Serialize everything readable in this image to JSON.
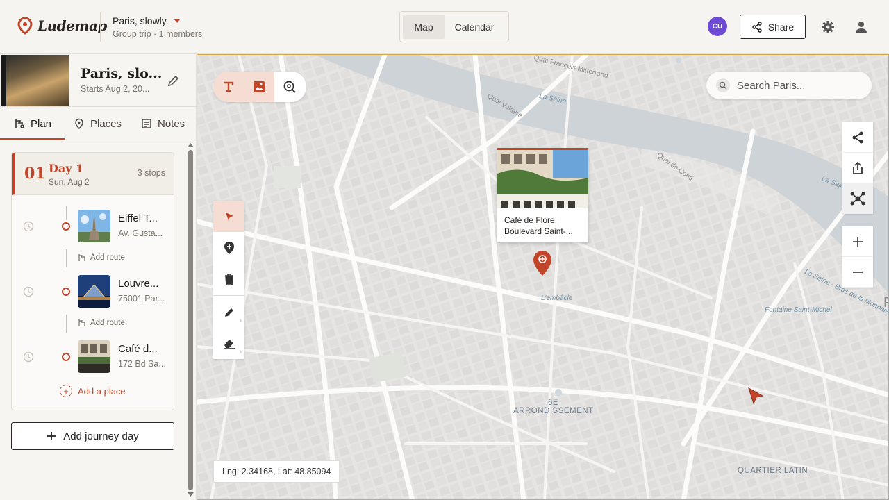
{
  "header": {
    "logo_text": "Ludemap",
    "trip_title": "Paris, slowly.",
    "trip_subtitle": "Group trip · 1 members",
    "view_tabs": [
      {
        "label": "Map",
        "active": true
      },
      {
        "label": "Calendar",
        "active": false
      }
    ],
    "avatar_initials": "CU",
    "share_label": "Share",
    "icons": [
      "settings-icon",
      "user-icon"
    ]
  },
  "sidebar": {
    "trip_name": "Paris, slo...",
    "trip_start": "Starts Aug 2, 20...",
    "tabs": [
      {
        "label": "Plan",
        "icon": "plan-icon",
        "active": true
      },
      {
        "label": "Places",
        "icon": "pin-icon",
        "active": false
      },
      {
        "label": "Notes",
        "icon": "notes-icon",
        "active": false
      }
    ],
    "day": {
      "number": "01",
      "name": "Day 1",
      "date": "Sun, Aug 2",
      "stops_count": "3 stops",
      "stops": [
        {
          "name": "Eiffel T...",
          "address": "Av. Gusta..."
        },
        {
          "name": "Louvre...",
          "address": "75001 Par..."
        },
        {
          "name": "Café d...",
          "address": "172 Bd Sa..."
        }
      ],
      "add_route_label": "Add route",
      "add_place_label": "Add a place"
    },
    "add_day_label": "Add journey day"
  },
  "map": {
    "search_placeholder": "Search Paris...",
    "popup_title": "Café de Flore, Boulevard Saint-...",
    "coordinates": "Lng: 2.34168, Lat: 48.85094",
    "labels": {
      "quai_mitterrand": "Quai François Mitterrand",
      "quai_voltaire": "Quai Voltaire",
      "la_seine_1": "La Seine",
      "quai_conti": "Quai de Conti",
      "la_seine_2": "La Seine",
      "la_seine_bras": "La Seine - Bras de la Monnaie",
      "fontaine": "Fontaine Saint-Michel",
      "embacle": "L'embâcle",
      "district_6e_1": "6E",
      "district_6e_2": "ARRONDISSEMENT",
      "quartier_latin": "QUARTIER LATIN",
      "edge_letter": "P"
    }
  },
  "colors": {
    "accent": "#c2452a",
    "avatar": "#6e4ad6",
    "map_border": "#d3a94a"
  }
}
